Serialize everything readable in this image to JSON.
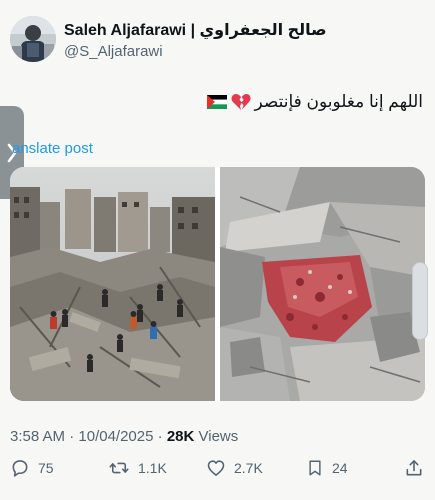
{
  "author": {
    "display_name": "Saleh Aljafarawi | صالح الجعفراوي",
    "handle": "@S_Aljafarawi"
  },
  "tweet": {
    "text": "اللهم إنا مغلوبون فإنتصر",
    "emoji_heart": "💔"
  },
  "translate": {
    "label": "anslate post"
  },
  "meta": {
    "time": "3:58 AM",
    "separator": " · ",
    "date": "10/04/2025",
    "views_count": "28K",
    "views_label": " Views"
  },
  "actions": {
    "replies": "75",
    "reposts": "1.1K",
    "likes": "2.7K",
    "bookmarks": "24"
  },
  "colors": {
    "link": "#1d9bf0",
    "secondary_text": "#536471",
    "primary_text": "#0f1419"
  },
  "icons": [
    "chevron-right-icon",
    "reply-icon",
    "repost-icon",
    "like-icon",
    "bookmark-icon",
    "share-icon",
    "palestine-flag-icon",
    "broken-heart-icon"
  ]
}
